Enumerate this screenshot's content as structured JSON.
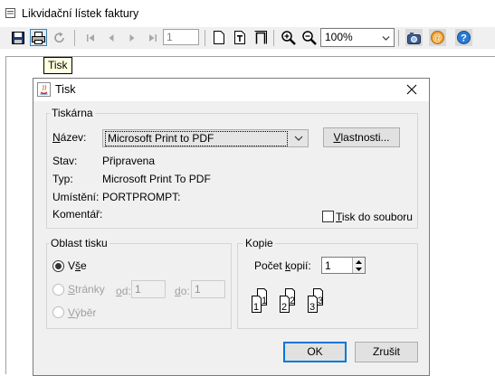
{
  "window": {
    "title": "Likvidační lístek faktury"
  },
  "toolbar": {
    "page_number": "1",
    "zoom": "100%"
  },
  "tooltip": "Tisk",
  "dialog": {
    "title": "Tisk",
    "printer": {
      "group_label": "Tiskárna",
      "name_label": "Název:",
      "name_value": "Microsoft Print to PDF",
      "properties_button": "Vlastnosti...",
      "status_label": "Stav:",
      "status_value": "Připravena",
      "type_label": "Typ:",
      "type_value": "Microsoft Print To PDF",
      "location_label": "Umístění:",
      "location_value": "PORTPROMPT:",
      "comment_label": "Komentář:",
      "print_to_file_label": "Tisk do souboru"
    },
    "range": {
      "group_label": "Oblast tisku",
      "all_label": "Vše",
      "pages_label": "Stránky",
      "from_label": "od:",
      "from_value": "1",
      "to_label": "do:",
      "to_value": "1",
      "selection_label": "Výběr"
    },
    "copies": {
      "group_label": "Kopie",
      "count_label": "Počet kopií:",
      "count_value": "1",
      "collate_pages": [
        "1",
        "1",
        "2",
        "2",
        "3",
        "3"
      ]
    },
    "ok_button": "OK",
    "cancel_button": "Zrušit"
  },
  "colors": {
    "accent": "#0078d7",
    "dialog_bg": "#f0f0f0",
    "tooltip_bg": "#ffffe1"
  },
  "icons": [
    "save-icon",
    "print-icon",
    "refresh-icon",
    "first-page-icon",
    "prev-page-icon",
    "next-page-icon",
    "last-page-icon",
    "page-icon",
    "page-width-icon",
    "whole-page-icon",
    "zoom-in-icon",
    "zoom-out-icon",
    "export-icon",
    "email-icon",
    "help-icon",
    "java-icon",
    "close-icon"
  ]
}
